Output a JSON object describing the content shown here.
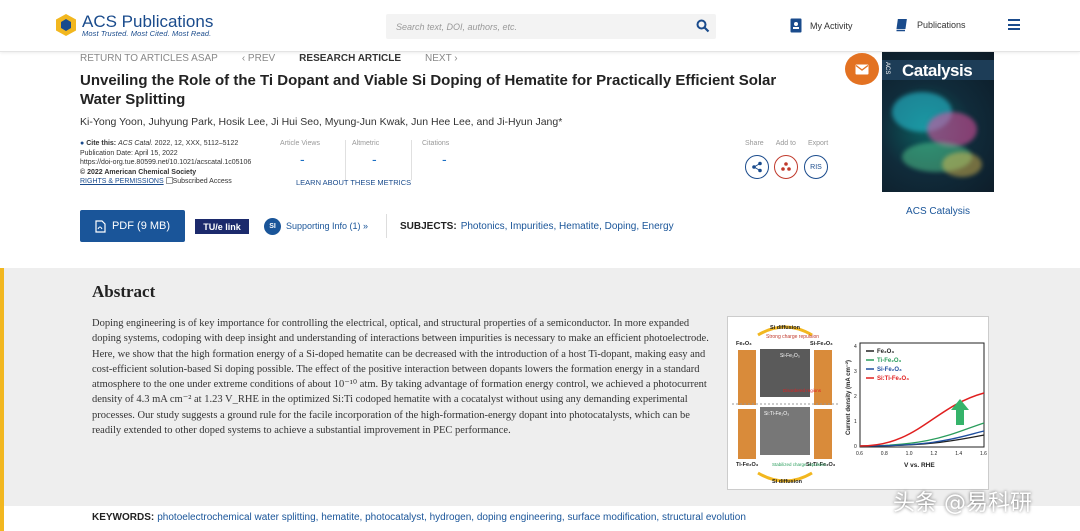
{
  "header": {
    "logo_name": "ACS Publications",
    "logo_tagline": "Most Trusted. Most Cited. Most Read.",
    "search_placeholder": "Search text, DOI, authors, etc.",
    "my_activity": "My Activity",
    "publications": "Publications"
  },
  "breadcrumb": {
    "back": "RETURN TO ARTICLES ASAP",
    "prev": "‹ PREV",
    "type": "RESEARCH ARTICLE",
    "next": "NEXT ›"
  },
  "article": {
    "title": "Unveiling the Role of the Ti Dopant and Viable Si Doping of Hematite for Practically Efficient Solar Water Splitting",
    "authors": "Ki-Yong Yoon, Juhyung Park, Hosik Lee, Ji Hui Seo, Myung-Jun Kwak, Jun Hee Lee, and Ji-Hyun Jang*",
    "cite_label": "Cite this:",
    "cite_journal": "ACS Catal.",
    "cite_details": "2022, 12, XXX, 5112–5122",
    "pub_date": "Publication Date: April 15, 2022",
    "doi": "https://doi-org.tue.80599.net/10.1021/acscatal.1c05106",
    "copyright": "© 2022 American Chemical Society",
    "rights": "RIGHTS & PERMISSIONS",
    "access": "Subscribed Access"
  },
  "metrics": {
    "views_label": "Article Views",
    "altmetric_label": "Altmetric",
    "citations_label": "Citations",
    "views_value": "-",
    "altmetric_value": "-",
    "citations_value": "-",
    "learn_more": "LEARN ABOUT THESE METRICS"
  },
  "actions": {
    "share": "Share",
    "add_to": "Add to",
    "export": "Export",
    "ris": "RIS",
    "pdf": "PDF (9 MB)",
    "tue_link": "TU/e link",
    "si_badge": "SI",
    "supporting_info": "Supporting Info (1) »"
  },
  "subjects": {
    "label": "SUBJECTS:",
    "items": "Photonics, Impurities, Hematite, Doping, Energy"
  },
  "journal": {
    "cover_title": "Catalysis",
    "cover_acs": "ACS",
    "name": "ACS Catalysis"
  },
  "abstract": {
    "heading": "Abstract",
    "text": "Doping engineering is of key importance for controlling the electrical, optical, and structural properties of a semiconductor. In more expanded doping systems, codoping with deep insight and understanding of interactions between impurities is necessary to make an efficient photoelectrode. Here, we show that the high formation energy of a Si-doped hematite can be decreased with the introduction of a host Ti-dopant, making easy and cost-efficient solution-based Si doping possible. The effect of the positive interaction between dopants lowers the formation energy in a standard atmosphere to the one under extreme conditions of about 10⁻¹⁰ atm. By taking advantage of formation energy control, we achieved a photocurrent density of 4.3 mA cm⁻² at 1.23 V_RHE in the optimized Si:Ti codoped hematite with a cocatalyst without using any demanding experimental processes. Our study suggests a ground rule for the facile incorporation of the high-formation-energy dopant into photocatalysts, which can be readily extended to other doped systems to achieve a substantial improvement in PEC performance."
  },
  "toc_graphic": {
    "top_label": "Si diffusion",
    "top_sub": "Strong charge repulsion",
    "bottom_sub": "Stabilized charge repulsion",
    "bottom_label": "Si diffusion",
    "lbl_fe2o3": "Fe₂O₃",
    "lbl_si_fe2o3": "Si-Fe₂O₃",
    "lbl_ti_fe2o3": "Ti-Fe₂O₃",
    "lbl_siti_fe2o3": "Si:Ti-Fe₂O₃",
    "disordered": "Disordered regions",
    "plot_ylabel": "Current density (mA cm⁻²)",
    "plot_xlabel": "V vs. RHE",
    "legend": [
      "Fe₂O₃",
      "Ti-Fe₂O₃",
      "Si-Fe₂O₃",
      "Si:Ti-Fe₂O₃"
    ],
    "legend_colors": [
      "#222222",
      "#2a9d5c",
      "#1f4fa0",
      "#e02020"
    ],
    "xticks": [
      "0.6",
      "0.8",
      "1.0",
      "1.2",
      "1.4",
      "1.6"
    ],
    "yticks": [
      "0",
      "1",
      "2",
      "3",
      "4"
    ]
  },
  "keywords": {
    "label": "KEYWORDS:",
    "items": "photoelectrochemical water splitting, hematite, photocatalyst, hydrogen, doping engineering, surface modification, structural evolution"
  },
  "watermark": "头条 @易科研"
}
